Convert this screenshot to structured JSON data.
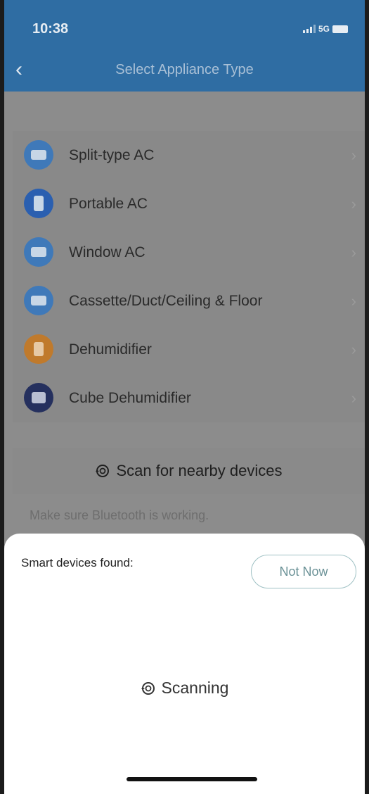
{
  "status_bar": {
    "time": "10:38",
    "network": "5G"
  },
  "header": {
    "title": "Select Appliance Type"
  },
  "appliances": [
    {
      "label": "Split-type AC",
      "icon": "split-ac-icon",
      "color": "#3f79b9"
    },
    {
      "label": "Portable AC",
      "icon": "portable-ac-icon",
      "color": "#2a5fb0"
    },
    {
      "label": "Window AC",
      "icon": "window-ac-icon",
      "color": "#3f79b9"
    },
    {
      "label": "Cassette/Duct/Ceiling & Floor",
      "icon": "cassette-ac-icon",
      "color": "#3f79b9"
    },
    {
      "label": "Dehumidifier",
      "icon": "dehumidifier-icon",
      "color": "#c07a2c"
    },
    {
      "label": "Cube Dehumidifier",
      "icon": "cube-dehumidifier-icon",
      "color": "#25305e"
    }
  ],
  "scan": {
    "label": "Scan for nearby devices",
    "hint": "Make sure Bluetooth is working."
  },
  "sheet": {
    "found_label": "Smart devices found:",
    "not_now_label": "Not Now",
    "scanning_label": "Scanning"
  }
}
